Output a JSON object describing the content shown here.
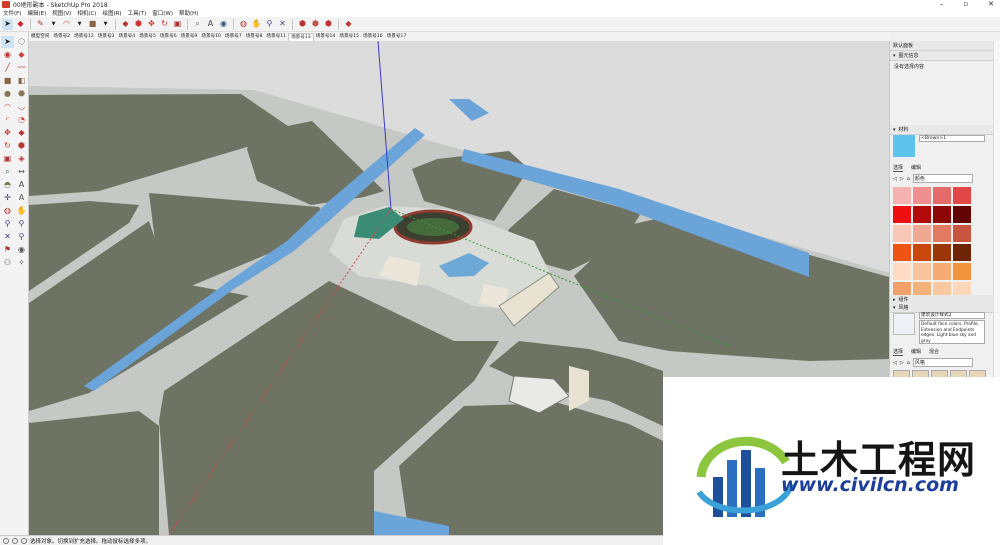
{
  "window": {
    "title": "00地形副本 - SketchUp Pro 2018",
    "controls": [
      "–",
      "▫",
      "✕"
    ]
  },
  "menu": [
    "文件(F)",
    "编辑(E)",
    "视图(V)",
    "相机(C)",
    "绘图(R)",
    "工具(T)",
    "窗口(W)",
    "帮助(H)"
  ],
  "scene_tabs": {
    "items": [
      "模型空间",
      "场景号2",
      "场景号12",
      "场景号3",
      "场景号4",
      "场景号5",
      "场景号6",
      "场景号9",
      "场景号10",
      "场景号7",
      "场景号8",
      "场景号11",
      "场景号13",
      "场景号14",
      "场景号15",
      "场景号16",
      "场景号17"
    ],
    "active_index": 12
  },
  "tray": {
    "title": "默认面板",
    "entity_info": {
      "header": "图元信息",
      "content": "没有选择内容"
    },
    "materials": {
      "header": "材料",
      "name": "<Brown>1",
      "tabs": [
        "选择",
        "编辑"
      ],
      "library": "颜色",
      "swatches": [
        "#f6b1b1",
        "#ee8e8e",
        "#e56a6a",
        "#e24747",
        "#ee1010",
        "#b10a0a",
        "#8d0707",
        "#610505",
        "#f9c7b8",
        "#f0a892",
        "#e27a62",
        "#c8553e",
        "#ee5413",
        "#c9460c",
        "#9a3607",
        "#6e2505",
        "#fddbc4",
        "#f9c49d",
        "#f5ab72",
        "#f19440",
        "#f4a06a",
        "#f3b27a",
        "#f9c8a0",
        "#fbd7bb"
      ]
    },
    "components": {
      "header": "组件"
    },
    "styles": {
      "header": "风格",
      "name": "建筑设计样式2",
      "description": "Default face colors. Profile, Extension and Endpoints edges. Light blue sky and gray",
      "tabs": [
        "选择",
        "编辑",
        "混合"
      ],
      "library": "风格",
      "thumb_labels": [
        "带有材质",
        "带有材质",
        "带有白色",
        "带有白色",
        "带有"
      ]
    }
  },
  "status": {
    "text": "选择对象。切换到扩充选择。拖动鼠标选择多项。"
  },
  "watermark": {
    "title": "土木工程网",
    "url": "www.civilcn.com"
  },
  "colors": {
    "block": "#6e7363",
    "road": "#c5c8c4",
    "river": "#6aa4d8",
    "sky": "#dadada"
  }
}
